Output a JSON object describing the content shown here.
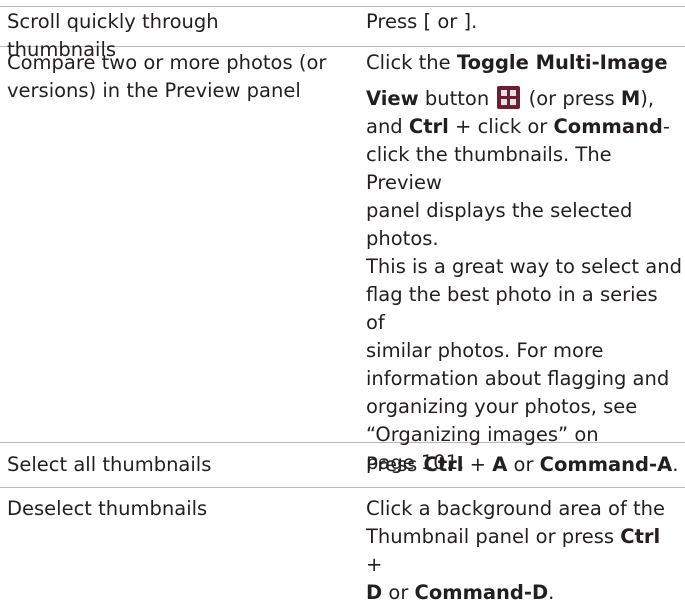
{
  "rows": [
    {
      "task": "Scroll quickly through thumbnails",
      "action": {
        "pre": "Press [ or ]."
      }
    },
    {
      "task": [
        "Compare two or more photos (or",
        "versions) in the Preview panel"
      ],
      "action": {
        "l1_pre": "Click the ",
        "l1_bold": "Toggle Multi-Image",
        "l2_bold": "View",
        "l2_mid": " button ",
        "icon": "multi-image-view-icon",
        "l2_post": " (or press ",
        "l2_key": "M",
        "l2_end": "),",
        "l3_pre": "and ",
        "l3_key1": "Ctrl",
        "l3_mid": " + click or ",
        "l3_key2": "Command",
        "l3_end": "-",
        "l4": "click the thumbnails. The Preview",
        "l5": "panel displays the selected",
        "l6": "photos.",
        "p2": [
          "This is a great way to select and",
          "flag the best photo in a series of",
          "similar photos. For more",
          "information about flagging and",
          "organizing your photos, see",
          "“Organizing images” on",
          "page 101."
        ]
      }
    },
    {
      "task": "Select all thumbnails",
      "action": {
        "pre": "Press ",
        "k1": "Ctrl",
        "mid": " + ",
        "k2": "A",
        "or": " or ",
        "k3": "Command-A",
        "end": "."
      }
    },
    {
      "task": "Deselect thumbnails",
      "action": {
        "l1": "Click a background area of the",
        "l2_pre": "Thumbnail panel or press ",
        "l2_key": "Ctrl",
        "l2_end": " +",
        "l3_key1": "D",
        "l3_mid": " or ",
        "l3_key2": "Command-D",
        "l3_end": "."
      }
    }
  ]
}
